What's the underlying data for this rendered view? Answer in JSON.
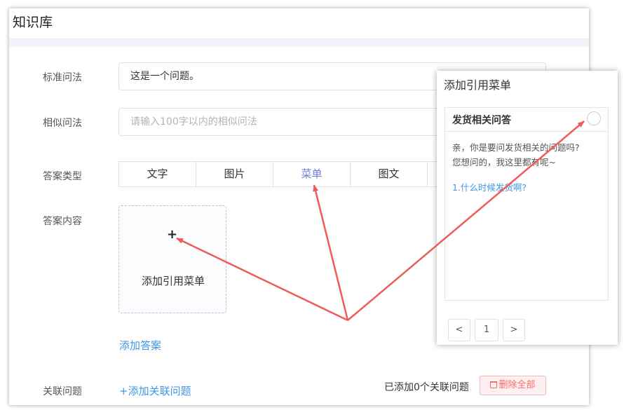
{
  "header": {
    "title": "知识库"
  },
  "form": {
    "standard_label": "标准问法",
    "standard_value": "这是一个问题。",
    "similar_label": "相似问法",
    "similar_placeholder": "请输入100字以内的相似问法",
    "answer_type_label": "答案类型",
    "answer_type_tabs": [
      "文字",
      "图片",
      "菜单",
      "图文",
      ""
    ],
    "answer_type_selected": "菜单",
    "answer_content_label": "答案内容",
    "add_menu_plus": "+",
    "add_menu_text": "添加引用菜单",
    "add_answer_link": "添加答案",
    "related_label": "关联问题",
    "add_related_link": "+添加关联问题",
    "related_count_text": "已添加0个关联问题",
    "delete_all_button": "删除全部"
  },
  "popup": {
    "title": "添加引用菜单",
    "card": {
      "title": "发货相关问答",
      "body_line1": "亲，你是要问发货相关的问题吗?",
      "body_line2": "您想问的，我这里都有呢~",
      "item_link": "1.什么时候发货啊?"
    },
    "pagination": {
      "prev": "<",
      "page": "1",
      "next": ">"
    }
  },
  "colors": {
    "accent": "#6c7ad6",
    "link": "#3f97e6",
    "arrow": "#ee5b5b",
    "danger": "#f56c6c"
  },
  "icons": [
    "plus-icon",
    "trash-icon",
    "chevron-left-icon",
    "chevron-right-icon",
    "radio-icon"
  ]
}
